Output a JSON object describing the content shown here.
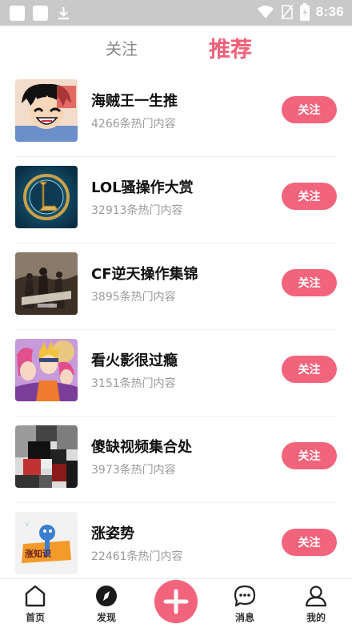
{
  "status_bar": {
    "time": "8:36"
  },
  "tabs": [
    {
      "label": "关注",
      "active": false
    },
    {
      "label": "推荐",
      "active": true
    }
  ],
  "items": [
    {
      "title": "海贼王一生推",
      "subtitle": "4266条热门内容",
      "button": "关注",
      "thumb": "anime-boy-straw-hat"
    },
    {
      "title": "LOL骚操作大赏",
      "subtitle": "32913条热门内容",
      "button": "关注",
      "thumb": "lol-logo"
    },
    {
      "title": "CF逆天操作集锦",
      "subtitle": "3895条热门内容",
      "button": "关注",
      "thumb": "shooter-game-poster"
    },
    {
      "title": "看火影很过瘾",
      "subtitle": "3151条热门内容",
      "button": "关注",
      "thumb": "naruto-characters"
    },
    {
      "title": "傻缺视频集合处",
      "subtitle": "3973条热门内容",
      "button": "关注",
      "thumb": "pixel-figure"
    },
    {
      "title": "涨姿势",
      "subtitle": "22461条热门内容",
      "button": "关注",
      "thumb": "knowledge-logo",
      "thumb_text": "涨知识"
    }
  ],
  "bottom_nav": {
    "home": "首页",
    "discover": "发现",
    "messages": "消息",
    "mine": "我的"
  },
  "colors": {
    "accent": "#f2647c",
    "status_bar": "#c9c9c9"
  }
}
